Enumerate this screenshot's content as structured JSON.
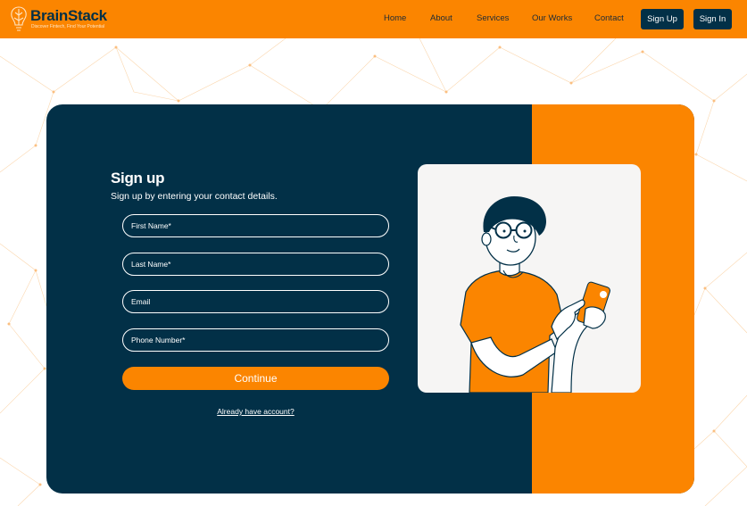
{
  "brand": {
    "name": "BrainStack",
    "tagline": "Discover Fintech, Find Your Potential",
    "logo_icon": "brain-bulb-icon"
  },
  "nav": {
    "links": [
      "Home",
      "About",
      "Services",
      "Our Works",
      "Contact"
    ],
    "signup_label": "Sign Up",
    "signin_label": "Sign In"
  },
  "form": {
    "title": "Sign up",
    "subtitle": "Sign up by entering your contact details.",
    "fields": [
      {
        "placeholder": "First Name*",
        "value": ""
      },
      {
        "placeholder": "Last Name*",
        "value": ""
      },
      {
        "placeholder": "Email",
        "value": ""
      },
      {
        "placeholder": "Phone Number*",
        "value": ""
      }
    ],
    "continue_label": "Continue",
    "account_link": "Already have account?"
  },
  "illustration": {
    "subject": "person-using-phone-illustration"
  },
  "colors": {
    "accent": "#fb8500",
    "dark": "#023047",
    "white": "#ffffff",
    "illustration_bg": "#f6f5f4"
  }
}
